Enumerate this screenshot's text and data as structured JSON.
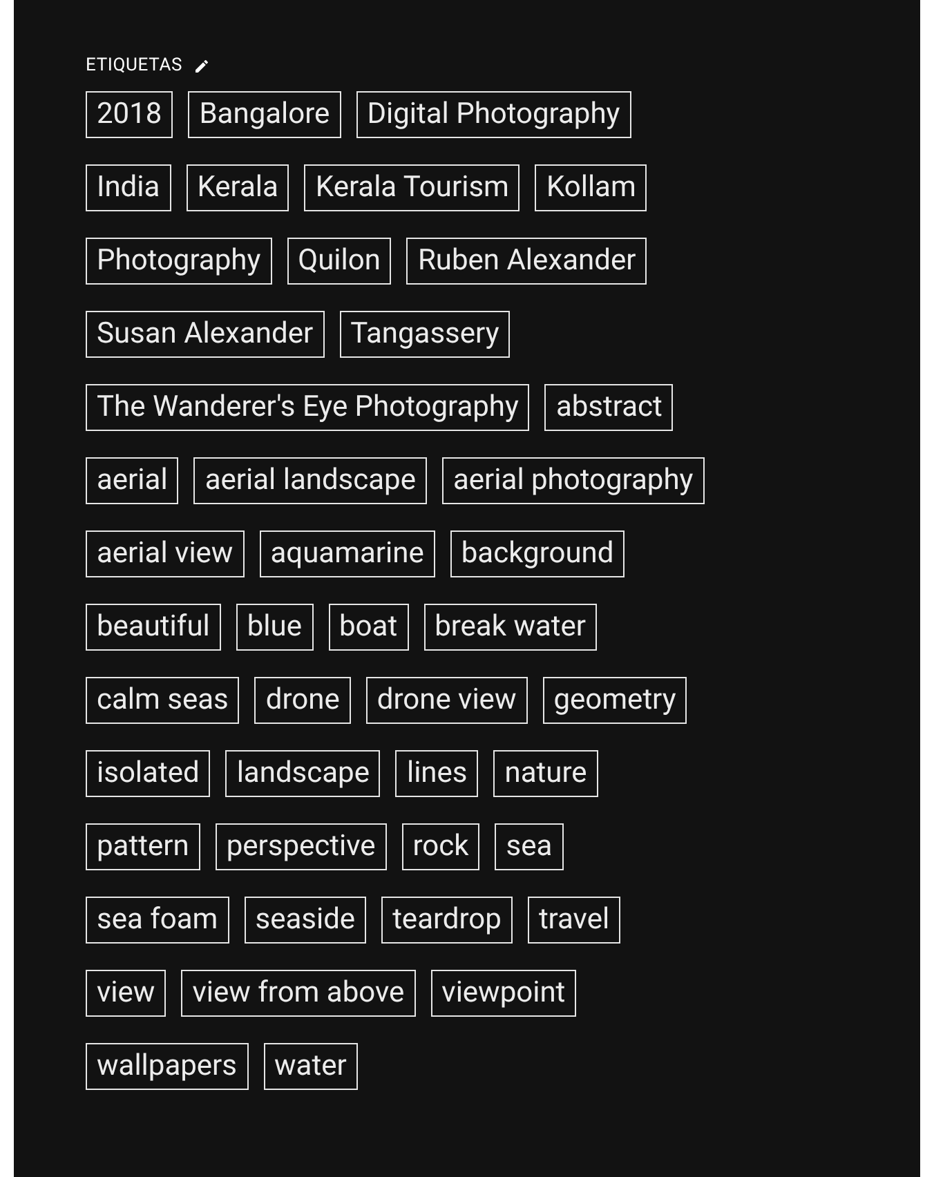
{
  "header": {
    "title": "ETIQUETAS"
  },
  "tag_rows": [
    [
      "2018",
      "Bangalore",
      "Digital Photography"
    ],
    [
      "India",
      "Kerala",
      "Kerala Tourism",
      "Kollam"
    ],
    [
      "Photography",
      "Quilon",
      "Ruben Alexander"
    ],
    [
      "Susan Alexander",
      "Tangassery"
    ],
    [
      "The Wanderer's Eye Photography",
      "abstract"
    ],
    [
      "aerial",
      "aerial landscape",
      "aerial photography"
    ],
    [
      "aerial view",
      "aquamarine",
      "background"
    ],
    [
      "beautiful",
      "blue",
      "boat",
      "break water"
    ],
    [
      "calm seas",
      "drone",
      "drone view",
      "geometry"
    ],
    [
      "isolated",
      "landscape",
      "lines",
      "nature"
    ],
    [
      "pattern",
      "perspective",
      "rock",
      "sea"
    ],
    [
      "sea foam",
      "seaside",
      "teardrop",
      "travel"
    ],
    [
      "view",
      "view from above",
      "viewpoint"
    ],
    [
      "wallpapers",
      "water"
    ]
  ]
}
